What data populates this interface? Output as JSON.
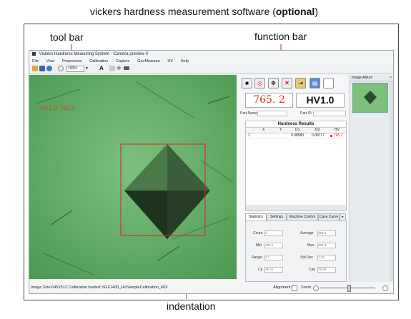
{
  "annotations": {
    "title_prefix": "vickers hardness measurement software (",
    "title_bold": "optional",
    "title_suffix": ")",
    "tool_bar": "tool bar",
    "function_bar": "function bar",
    "indentation": "indentation"
  },
  "window": {
    "title": "Vickers Hardness Measuring System - Camera preview 0",
    "menu": [
      "File",
      "View",
      "Preprocess",
      "Calibration",
      "Capture",
      "GeoMeasure",
      "HV",
      "Help"
    ],
    "zoom_value": "100%",
    "image_overlay_label": "HV1.0: 765.2"
  },
  "readout": {
    "value": "765. 2",
    "scale": "HV1.0"
  },
  "fields": {
    "part_name": "Part Name:",
    "part_id": "Part ID:"
  },
  "results": {
    "title": "Hardness Results",
    "columns": [
      "X",
      "Y",
      "D1",
      "D2",
      "HV"
    ],
    "rows": [
      {
        "idx": "1",
        "x": "",
        "y": "",
        "d1": "0.08583",
        "d2": "0.08717",
        "hv": "765.2"
      }
    ]
  },
  "tabs": [
    "Statistics",
    "Settings",
    "Machine Control",
    "Case Curve"
  ],
  "stats": {
    "count_label": "Count",
    "count": "2",
    "average_label": "Average",
    "average": "355.6",
    "min_label": "Min",
    "min": "199.1",
    "max_label": "Max",
    "max": "302.3",
    "range_label": "Range",
    "range": "3.1",
    "std_label": "Std Dev",
    "std": "1.33",
    "cp_label": "Cp",
    "cp": "26.41",
    "cpk_label": "Cpk",
    "cpk": "75.84"
  },
  "album": {
    "title": "Image Album"
  },
  "status": {
    "left": "Image Size:645X512  Calibration loaded: 6GX1400_HVSampleCalibration_40X",
    "alignment": "Alignment:",
    "zoom": "Zoom"
  },
  "colors": {
    "image_green": "#6aae6a",
    "red_readout": "#e03020",
    "selection": "#e02020"
  }
}
